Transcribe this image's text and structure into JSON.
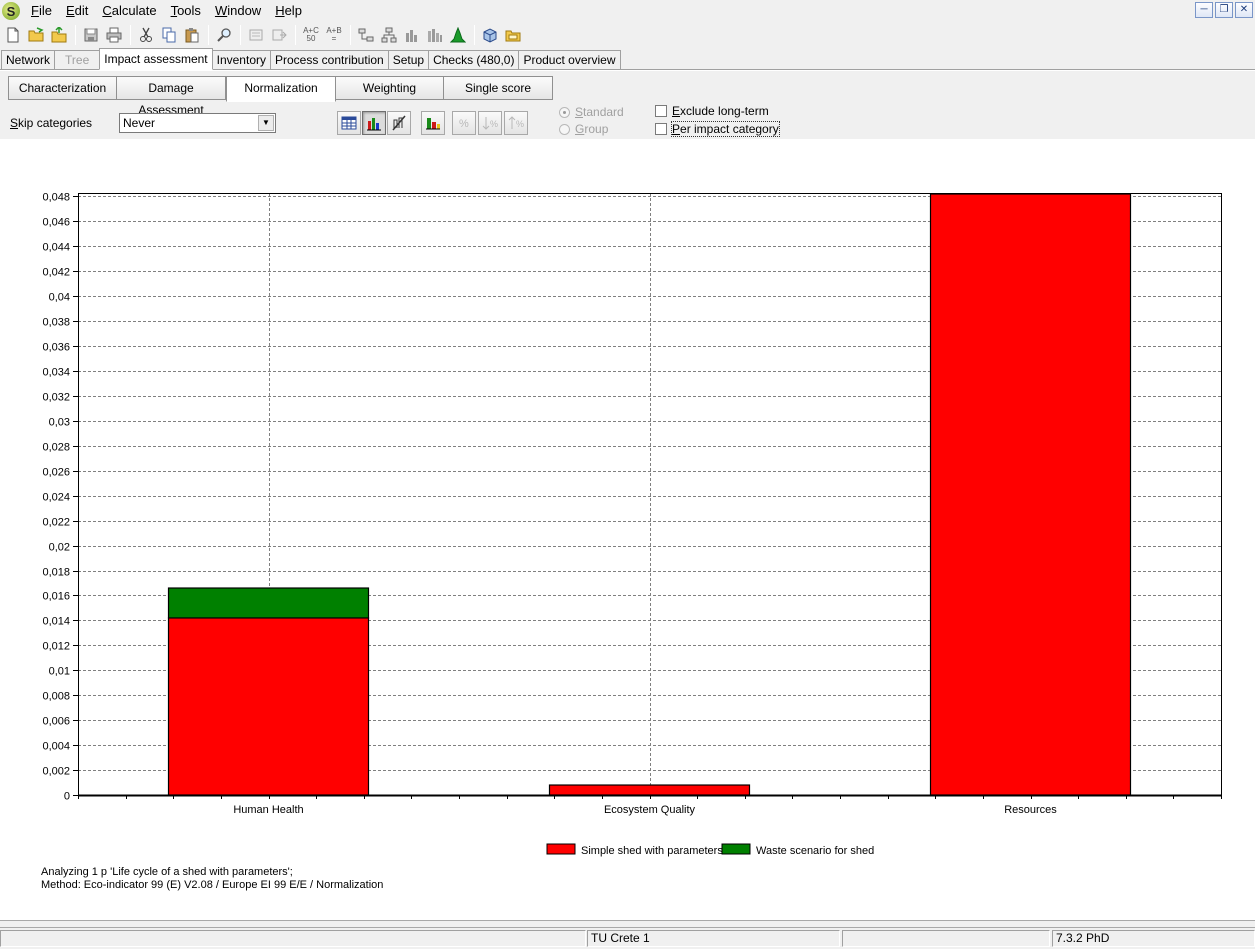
{
  "menu": {
    "items": [
      {
        "label": "File",
        "key": "F",
        "rest": "ile"
      },
      {
        "label": "Edit",
        "key": "E",
        "rest": "dit"
      },
      {
        "label": "Calculate",
        "key": "C",
        "rest": "alculate"
      },
      {
        "label": "Tools",
        "key": "T",
        "rest": "ools"
      },
      {
        "label": "Window",
        "key": "W",
        "rest": "indow"
      },
      {
        "label": "Help",
        "key": "H",
        "rest": "elp"
      }
    ]
  },
  "toolbar": {
    "compare_label_top": "A+C",
    "compare_label_bottom": "50",
    "add_label_top": "A+B",
    "add_label_bottom": "="
  },
  "tabs": {
    "items": [
      {
        "label": "Network",
        "state": "normal"
      },
      {
        "label": "Tree",
        "state": "disabled"
      },
      {
        "label": "Impact assessment",
        "state": "active"
      },
      {
        "label": "Inventory",
        "state": "normal"
      },
      {
        "label": "Process contribution",
        "state": "normal"
      },
      {
        "label": "Setup",
        "state": "normal"
      },
      {
        "label": "Checks (480,0)",
        "state": "normal"
      },
      {
        "label": "Product overview",
        "state": "normal"
      }
    ]
  },
  "subtabs": {
    "characterization": "Characterization",
    "damage": "Damage Assessment",
    "normalization": "Normalization",
    "weighting": "Weighting",
    "single_score": "Single score"
  },
  "controls": {
    "skip_label_key": "S",
    "skip_label_rest": "kip categories",
    "skip_value": "Never",
    "radio_standard_key": "S",
    "radio_standard_rest": "tandard",
    "radio_group_key": "G",
    "radio_group_rest": "roup",
    "exclude_key": "E",
    "exclude_rest": "xclude long-term",
    "per_impact_key": "P",
    "per_impact_rest": "er impact category"
  },
  "chart_data": {
    "type": "bar",
    "stacked": true,
    "categories": [
      "Human Health",
      "Ecosystem Quality",
      "Resources"
    ],
    "series": [
      {
        "name": "Simple shed with parameters",
        "color": "#ff0000",
        "values": [
          0.0142,
          0.0008,
          0.0482
        ]
      },
      {
        "name": "Waste scenario for shed",
        "color": "#008000",
        "values": [
          0.0024,
          0.0,
          0.0
        ]
      }
    ],
    "ylim": [
      0,
      0.0482
    ],
    "yticks": [
      0,
      0.002,
      0.004,
      0.006,
      0.008,
      0.01,
      0.012,
      0.014,
      0.016,
      0.018,
      0.02,
      0.022,
      0.024,
      0.026,
      0.028,
      0.03,
      0.032,
      0.034,
      0.036,
      0.038,
      0.04,
      0.042,
      0.044,
      0.046,
      0.048
    ],
    "ytick_labels": [
      "0",
      "0,002",
      "0,004",
      "0,006",
      "0,008",
      "0,01",
      "0,012",
      "0,014",
      "0,016",
      "0,018",
      "0,02",
      "0,022",
      "0,024",
      "0,026",
      "0,028",
      "0,03",
      "0,032",
      "0,034",
      "0,036",
      "0,038",
      "0,04",
      "0,042",
      "0,044",
      "0,046",
      "0,048"
    ],
    "grid": true,
    "legend": "bottom"
  },
  "info": {
    "line1": "Analyzing 1 p 'Life cycle of a shed with parameters';",
    "line2": "Method: Eco-indicator 99 (E) V2.08 / Europe EI 99 E/E / Normalization"
  },
  "status": {
    "cell1": "",
    "cell2": "TU Crete 1",
    "cell3": "",
    "cell4": "7.3.2 PhD"
  }
}
